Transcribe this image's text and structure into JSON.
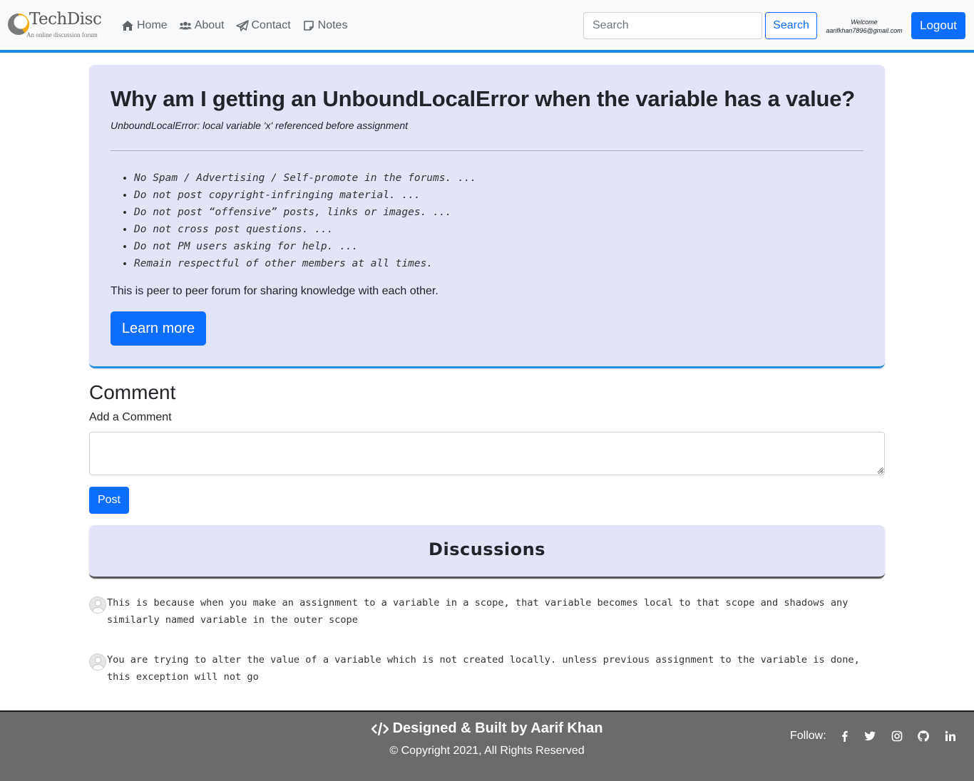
{
  "brand": {
    "name": "TechDisc",
    "tagline": "An online discussion forum"
  },
  "nav": {
    "links": [
      {
        "label": "Home",
        "icon": "home-icon"
      },
      {
        "label": "About",
        "icon": "users-icon"
      },
      {
        "label": "Contact",
        "icon": "paper-plane-icon"
      },
      {
        "label": "Notes",
        "icon": "note-icon"
      }
    ],
    "search_placeholder": "Search",
    "search_button": "Search",
    "welcome_label": "Welcome",
    "user_email": "aarifkhan7896@gmail.com",
    "logout_button": "Logout"
  },
  "question": {
    "title": "Why am I getting an UnboundLocalError when the variable has a value?",
    "description": "UnboundLocalError: local variable 'x' referenced before assignment",
    "rules": [
      "No Spam / Advertising / Self-promote in the forums. ...",
      "Do not post copyright-infringing material. ...",
      "Do not post “offensive” posts, links or images. ...",
      "Do not cross post questions. ...",
      "Do not PM users asking for help. ...",
      "Remain respectful of other members at all times."
    ],
    "paragraph": "This is peer to peer forum for sharing knowledge with each other.",
    "learn_more": "Learn more"
  },
  "comment_form": {
    "heading": "Comment",
    "label": "Add a Comment",
    "value": "",
    "post_button": "Post"
  },
  "discussions": {
    "heading": "Discussions",
    "comments": [
      {
        "text": "This is because when you make an assignment to a variable in a scope, that variable becomes local to that scope and shadows any similarly named variable in the outer scope"
      },
      {
        "text": "You are trying to alter the value of a variable which is not created locally. unless previous assignment to the variable is done, this exception will not go"
      }
    ]
  },
  "footer": {
    "title": "Designed & Built by Aarif Khan",
    "copyright": "© Copyright 2021, All Rights Reserved",
    "follow_label": "Follow:",
    "social": [
      "facebook-icon",
      "twitter-icon",
      "instagram-icon",
      "github-icon",
      "linkedin-icon"
    ]
  },
  "colors": {
    "primary": "#0d6efd",
    "nav_underline": "#1e88e5",
    "card_bg": "#e3e4f8",
    "footer_bg": "#6b6b6b"
  }
}
